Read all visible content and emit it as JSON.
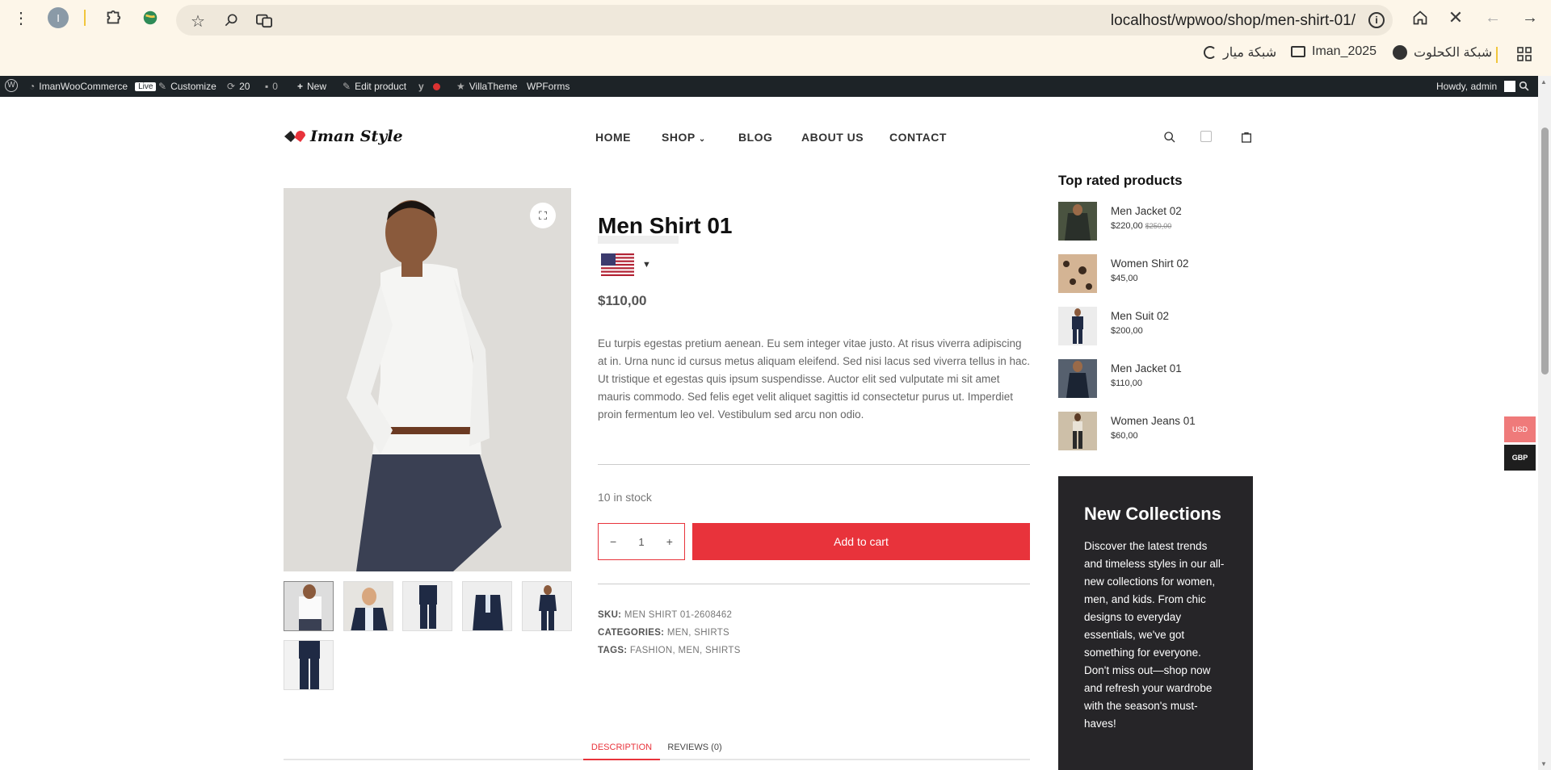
{
  "browser": {
    "url": "localhost/wpwoo/shop/men-shirt-01/",
    "profile_initial": "I",
    "bookmarks": [
      "شبكة الكحلوت",
      "Iman_2025",
      "شبكة ميار"
    ]
  },
  "wp_admin_bar": {
    "site_name": "ImanWooCommerce",
    "live_badge": "Live",
    "customize": "Customize",
    "updates_count": "20",
    "comments_count": "0",
    "new": "New",
    "edit_product": "Edit product",
    "villatheme": "VillaTheme",
    "wpforms": "WPForms",
    "howdy": "Howdy, admin"
  },
  "header": {
    "logo_text": "Iman Style",
    "nav": [
      "HOME",
      "SHOP",
      "BLOG",
      "ABOUT US",
      "CONTACT"
    ]
  },
  "product": {
    "title": "Men Shirt 01",
    "price": "$110,00",
    "description": "Eu turpis egestas pretium aenean. Eu sem integer vitae justo. At risus viverra adipiscing at in. Urna nunc id cursus metus aliquam eleifend. Sed nisi lacus sed viverra tellus in hac. Ut tristique et egestas quis ipsum suspendisse. Auctor elit sed vulputate mi sit amet mauris commodo. Sed felis eget velit aliquet sagittis id consectetur purus ut. Imperdiet proin fermentum leo vel. Vestibulum sed arcu non odio.",
    "stock": "10 in stock",
    "quantity": "1",
    "add_to_cart": "Add to cart",
    "sku_label": "SKU:",
    "sku": "MEN SHIRT 01-2608462",
    "categories_label": "CATEGORIES:",
    "categories": "MEN, SHIRTS",
    "tags_label": "TAGS:",
    "tags": "FASHION, MEN, SHIRTS"
  },
  "tabs": [
    "DESCRIPTION",
    "REVIEWS (0)"
  ],
  "sidebar": {
    "top_rated_title": "Top rated products",
    "top_rated": [
      {
        "name": "Men Jacket 02",
        "price": "$220,00",
        "old_price": "$250,00"
      },
      {
        "name": "Women Shirt 02",
        "price": "$45,00"
      },
      {
        "name": "Men Suit 02",
        "price": "$200,00"
      },
      {
        "name": "Men Jacket 01",
        "price": "$110,00"
      },
      {
        "name": "Women Jeans 01",
        "price": "$60,00"
      }
    ],
    "promo_title": "New Collections",
    "promo_text": "Discover the latest trends and timeless styles in our all-new collections for women, men, and kids. From chic designs to everyday essentials, we've got something for everyone. Don't miss out—shop now and refresh your wardrobe with the season's must-haves!"
  },
  "currency_switcher": [
    "USD",
    "GBP"
  ],
  "colors": {
    "accent": "#e8333b",
    "wp_bar": "#1d2327",
    "promo_bg": "#262528",
    "chrome_bg": "#fdf6e9"
  }
}
